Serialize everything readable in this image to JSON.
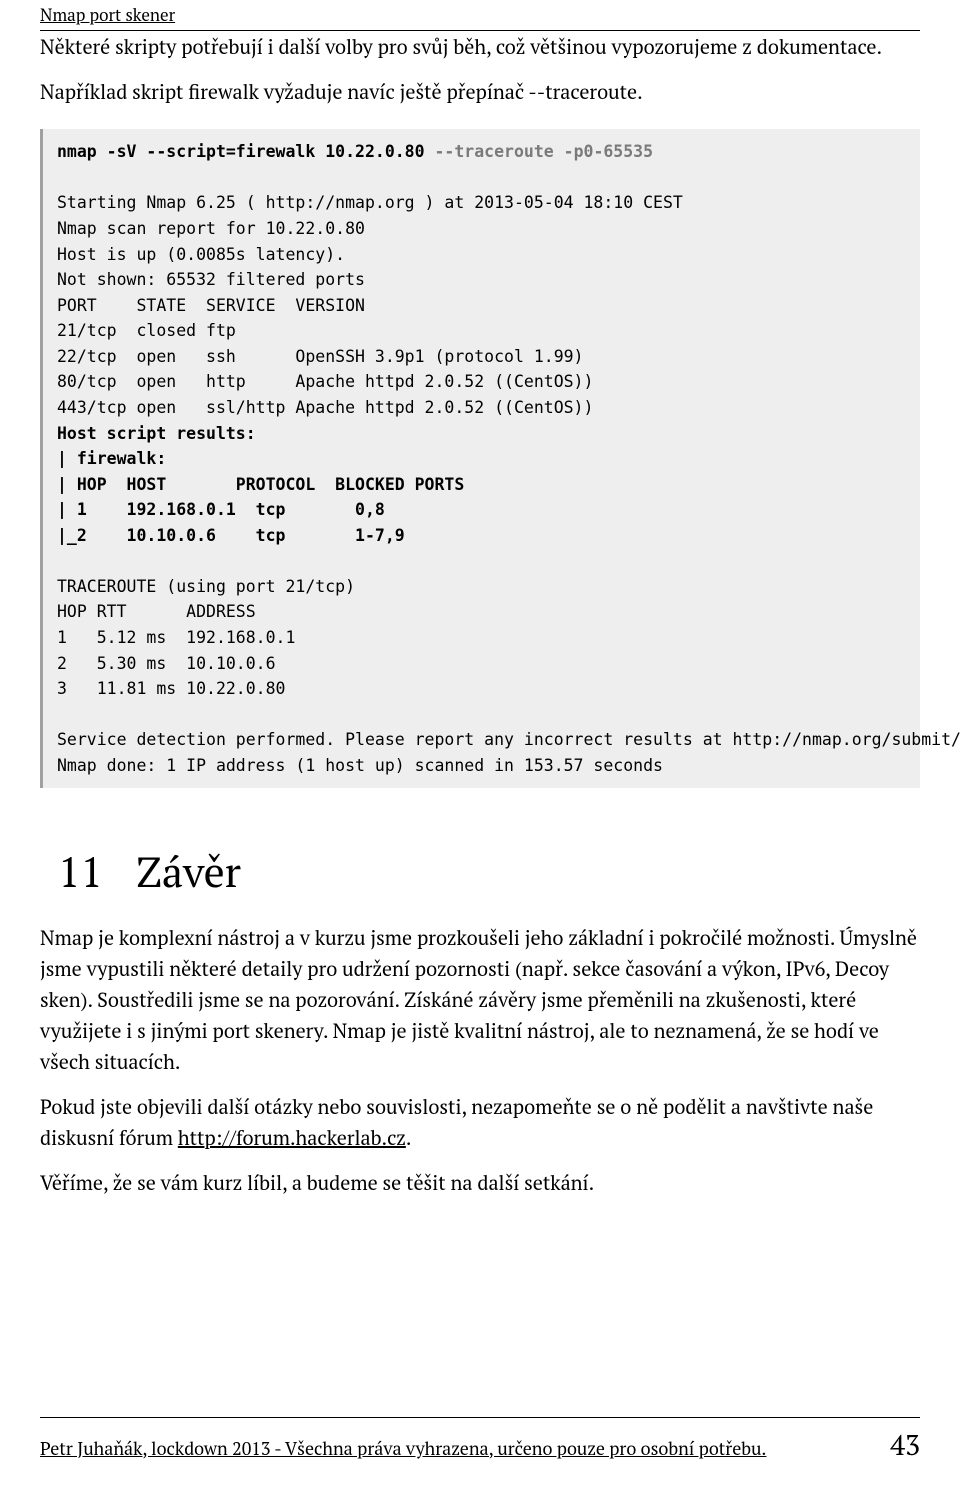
{
  "runningHeader": "Nmap port skener",
  "intro1": "Některé skripty potřebují i další volby pro svůj běh, což většinou vypozorujeme z dokumentace.",
  "intro2": "Například skript firewalk vyžaduje navíc ještě přepínač --traceroute.",
  "code": {
    "cmd_pre": "nmap -sV --script=firewalk 10.22.0.80 ",
    "cmd_grey": "--traceroute -p0-65535",
    "l2": "Starting Nmap 6.25 ( http://nmap.org ) at 2013-05-04 18:10 CEST",
    "l3": "Nmap scan report for 10.22.0.80",
    "l4": "Host is up (0.0085s latency).",
    "l5": "Not shown: 65532 filtered ports",
    "l6": "PORT    STATE  SERVICE  VERSION",
    "l7": "21/tcp  closed ftp",
    "l8": "22/tcp  open   ssh      OpenSSH 3.9p1 (protocol 1.99)",
    "l9": "80/tcp  open   http     Apache httpd 2.0.52 ((CentOS))",
    "l10": "443/tcp open   ssl/http Apache httpd 2.0.52 ((CentOS))",
    "b1": "Host script results:",
    "b2": "| firewalk:",
    "b3": "| HOP  HOST       PROTOCOL  BLOCKED PORTS",
    "b4": "| 1    192.168.0.1  tcp       0,8",
    "b5": "|_2    10.10.0.6    tcp       1-7,9",
    "t1": "TRACEROUTE (using port 21/tcp)",
    "t2": "HOP RTT      ADDRESS",
    "t3": "1   5.12 ms  192.168.0.1",
    "t4": "2   5.30 ms  10.10.0.6",
    "t5": "3   11.81 ms 10.22.0.80",
    "f1": "Service detection performed. Please report any incorrect results at http://nmap.org/submit/ .",
    "f2": "Nmap done: 1 IP address (1 host up) scanned in 153.57 seconds"
  },
  "chapterNum": "11",
  "chapterTitle": "Závěr",
  "para1": "Nmap je komplexní nástroj a v kurzu jsme prozkoušeli jeho základní i pokročilé možnosti. Úmyslně jsme vypustili některé detaily pro udržení pozornosti (např. sekce časování a výkon, IPv6, Decoy sken). Soustředili jsme se na pozorování. Získáné závěry jsme přeměnili na zkušenosti, které využijete i s jinými port skenery. Nmap je jistě kvalitní nástroj, ale to neznamená, že se hodí ve všech situacích.",
  "para2a": "Pokud jste objevili další otázky nebo souvislosti, nezapomeňte se o ně podělit a navštivte naše diskusní fórum ",
  "para2_link": "http://forum.hackerlab.cz",
  "para2b": ".",
  "para3": "Věříme, že se vám kurz líbil, a budeme se těšit na další setkání.",
  "footerText": "Petr Juhaňák, lockdown 2013 - Všechna práva vyhrazena, určeno pouze pro osobní potřebu.",
  "pageNumber": "43"
}
